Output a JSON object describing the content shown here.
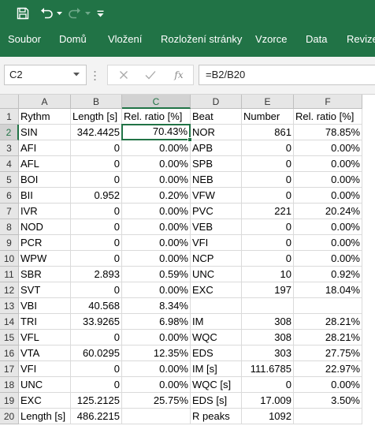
{
  "quick_access": {
    "save_icon": "save-icon",
    "undo_icon": "undo-icon",
    "redo_icon": "redo-icon",
    "customize_icon": "customize-quick-access-icon"
  },
  "ribbon": {
    "tabs": [
      "Soubor",
      "Domů",
      "Vložení",
      "Rozložení stránky",
      "Vzorce",
      "Data",
      "Revize"
    ]
  },
  "formula_bar": {
    "name_box": "C2",
    "cancel_icon": "cancel-icon",
    "enter_icon": "enter-icon",
    "fx_label": "fx",
    "formula": "=B2/B20"
  },
  "colors": {
    "accent": "#217346",
    "header_bg": "#e6e6e6",
    "grid_line": "#dadada"
  },
  "sheet": {
    "active_cell": "C2",
    "columns": [
      "A",
      "B",
      "C",
      "D",
      "E",
      "F"
    ],
    "rows": [
      {
        "num": "1",
        "cells": [
          "Rythm",
          "Length [s]",
          "Rel. ratio [%]",
          "Beat",
          "Number",
          "Rel. ratio [%]"
        ]
      },
      {
        "num": "2",
        "cells": [
          "SIN",
          "342.4425",
          "70.43%",
          "NOR",
          "861",
          "78.85%"
        ]
      },
      {
        "num": "3",
        "cells": [
          "AFI",
          "0",
          "0.00%",
          "APB",
          "0",
          "0.00%"
        ]
      },
      {
        "num": "4",
        "cells": [
          "AFL",
          "0",
          "0.00%",
          "SPB",
          "0",
          "0.00%"
        ]
      },
      {
        "num": "5",
        "cells": [
          "BOI",
          "0",
          "0.00%",
          "NEB",
          "0",
          "0.00%"
        ]
      },
      {
        "num": "6",
        "cells": [
          "BII",
          "0.952",
          "0.20%",
          "VFW",
          "0",
          "0.00%"
        ]
      },
      {
        "num": "7",
        "cells": [
          "IVR",
          "0",
          "0.00%",
          "PVC",
          "221",
          "20.24%"
        ]
      },
      {
        "num": "8",
        "cells": [
          "NOD",
          "0",
          "0.00%",
          "VEB",
          "0",
          "0.00%"
        ]
      },
      {
        "num": "9",
        "cells": [
          "PCR",
          "0",
          "0.00%",
          "VFI",
          "0",
          "0.00%"
        ]
      },
      {
        "num": "10",
        "cells": [
          "WPW",
          "0",
          "0.00%",
          "NCP",
          "0",
          "0.00%"
        ]
      },
      {
        "num": "11",
        "cells": [
          "SBR",
          "2.893",
          "0.59%",
          "UNC",
          "10",
          "0.92%"
        ]
      },
      {
        "num": "12",
        "cells": [
          "SVT",
          "0",
          "0.00%",
          "EXC",
          "197",
          "18.04%"
        ]
      },
      {
        "num": "13",
        "cells": [
          "VBI",
          "40.568",
          "8.34%",
          "",
          "",
          ""
        ]
      },
      {
        "num": "14",
        "cells": [
          "TRI",
          "33.9265",
          "6.98%",
          "IM",
          "308",
          "28.21%"
        ]
      },
      {
        "num": "15",
        "cells": [
          "VFL",
          "0",
          "0.00%",
          "WQC",
          "308",
          "28.21%"
        ]
      },
      {
        "num": "16",
        "cells": [
          "VTA",
          "60.0295",
          "12.35%",
          "EDS",
          "303",
          "27.75%"
        ]
      },
      {
        "num": "17",
        "cells": [
          "VFI",
          "0",
          "0.00%",
          "IM  [s]",
          "111.6785",
          "22.97%"
        ]
      },
      {
        "num": "18",
        "cells": [
          "UNC",
          "0",
          "0.00%",
          "WQC [s]",
          "0",
          "0.00%"
        ]
      },
      {
        "num": "19",
        "cells": [
          "EXC",
          "125.2125",
          "25.75%",
          "EDS [s]",
          "17.009",
          "3.50%"
        ]
      },
      {
        "num": "20",
        "cells": [
          "Length [s]",
          "486.2215",
          "",
          "R peaks",
          "1092",
          ""
        ]
      }
    ]
  }
}
